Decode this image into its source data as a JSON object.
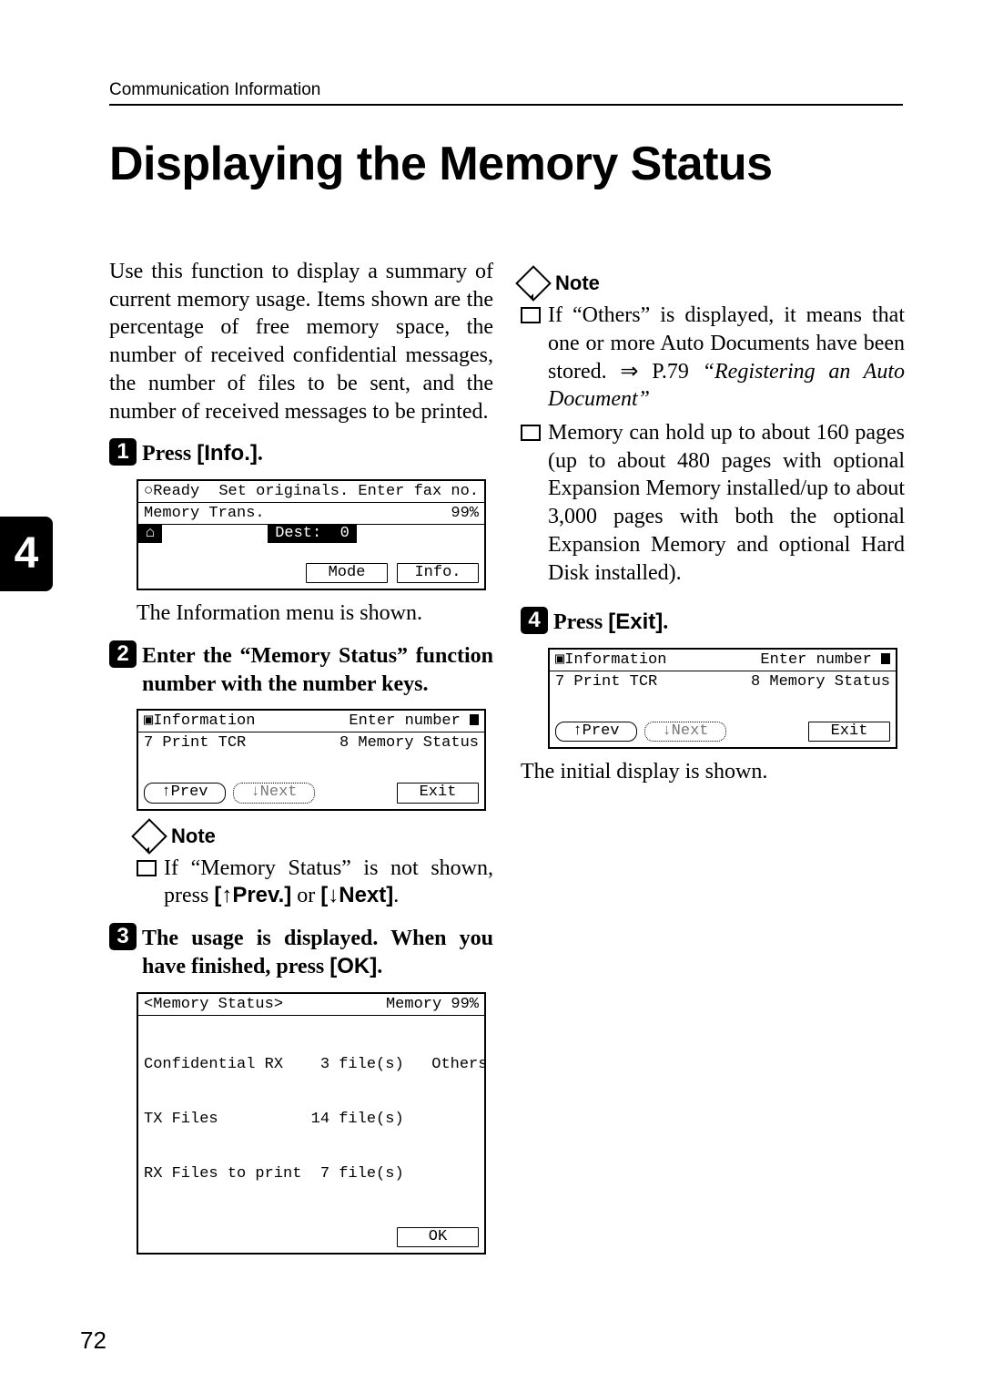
{
  "running_head": "Communication Information",
  "chapter_tab": "4",
  "title": "Displaying the Memory Status",
  "page_number": "72",
  "intro": "Use this function to display a summary of current memory usage. Items shown are the percentage of free memory space, the number of received confidential messages, the number of files to be sent, and the number of received messages to be printed.",
  "step1_text_a": "Press ",
  "step1_key": "[Info.]",
  "step1_text_b": ".",
  "lcd1": {
    "row1_left": "○Ready",
    "row1_right": "Set originals. Enter fax no.",
    "row2_left": "Memory Trans.",
    "row2_right": "99%",
    "row3_seg": "⌂",
    "row3_right": "Dest:  0",
    "btn_mode": "Mode",
    "btn_info": "Info."
  },
  "after_lcd1": "The Information menu is shown.",
  "step2_text": "Enter the “Memory Status” function number with the number keys.",
  "lcd2": {
    "row1_left": "▣Information",
    "row1_right": "Enter number",
    "row2_left": "7 Print TCR",
    "row2_right": "8 Memory Status",
    "btn_prev": "↑Prev",
    "btn_next": "↓Next",
    "btn_exit": "Exit"
  },
  "note_label": "Note",
  "left_note_text_a": "If “Memory Status” is not shown, press ",
  "left_note_key1": "[↑Prev.]",
  "left_note_or": " or ",
  "left_note_key2": "[↓Next]",
  "left_note_text_b": ".",
  "step3_text_a": "The usage is displayed. When you have finished, press ",
  "step3_key": "[OK]",
  "step3_text_b": ".",
  "lcd3": {
    "row1_left": "<Memory Status>",
    "row1_right": "Memory 99%",
    "body_l1": "Confidential RX    3 file(s)   Others",
    "body_l2": "TX Files          14 file(s)",
    "body_l3": "RX Files to print  7 file(s)",
    "btn_ok": "OK"
  },
  "right_notes": {
    "n1_a": "If “Others” is displayed, it means that one or more Auto Documents have been stored. ⇒ P.79 ",
    "n1_b_italic": "“Registering an Auto Document”",
    "n2": "Memory can hold up to about 160 pages (up to about 480 pages with optional Expansion Memory installed/up to about 3,000 pages with both the optional Expansion Memory and optional Hard Disk installed)."
  },
  "step4_text_a": "Press ",
  "step4_key": "[Exit]",
  "step4_text_b": ".",
  "lcd4": {
    "row1_left": "▣Information",
    "row1_right": "Enter number",
    "row2_left": "7 Print TCR",
    "row2_right": "8 Memory Status",
    "btn_prev": "↑Prev",
    "btn_next": "↓Next",
    "btn_exit": "Exit"
  },
  "after_lcd4": "The initial display is shown."
}
